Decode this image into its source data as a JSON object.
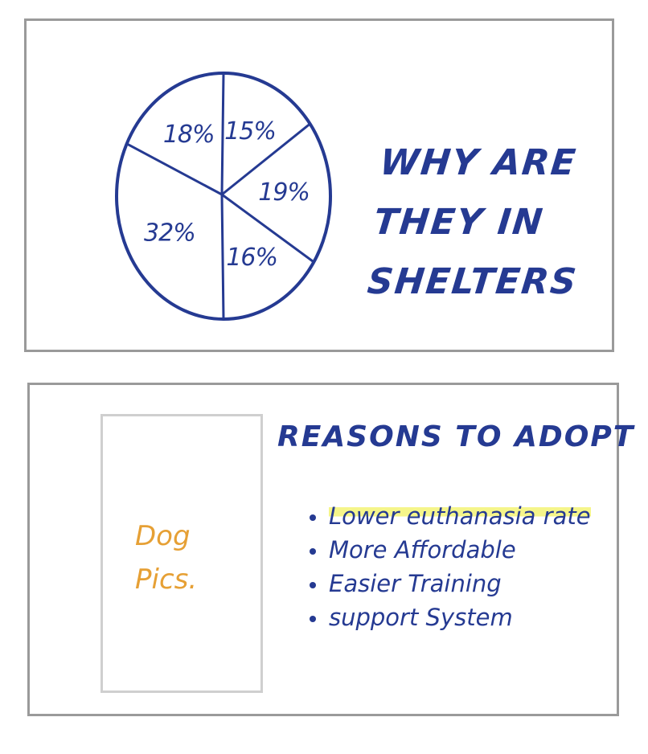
{
  "colors": {
    "ink": "#253a92",
    "accent": "#e6a035",
    "highlight": "#f5f58a",
    "frame": "#9a9a9a"
  },
  "top_panel": {
    "title_lines": [
      "WHY ARE",
      "THEY IN",
      "SHELTERS"
    ]
  },
  "chart_data": {
    "type": "pie",
    "title": "",
    "slices": [
      {
        "label": "15%",
        "value": 15
      },
      {
        "label": "19%",
        "value": 19
      },
      {
        "label": "16%",
        "value": 16
      },
      {
        "label": "32%",
        "value": 32
      },
      {
        "label": "18%",
        "value": 18
      }
    ]
  },
  "bottom_panel": {
    "title": "REASONS TO ADOPT",
    "photo_placeholder": [
      "Dog",
      "Pics."
    ],
    "reasons": [
      "Lower euthanasia rate",
      "More Affordable",
      "Easier Training",
      "support System"
    ]
  }
}
